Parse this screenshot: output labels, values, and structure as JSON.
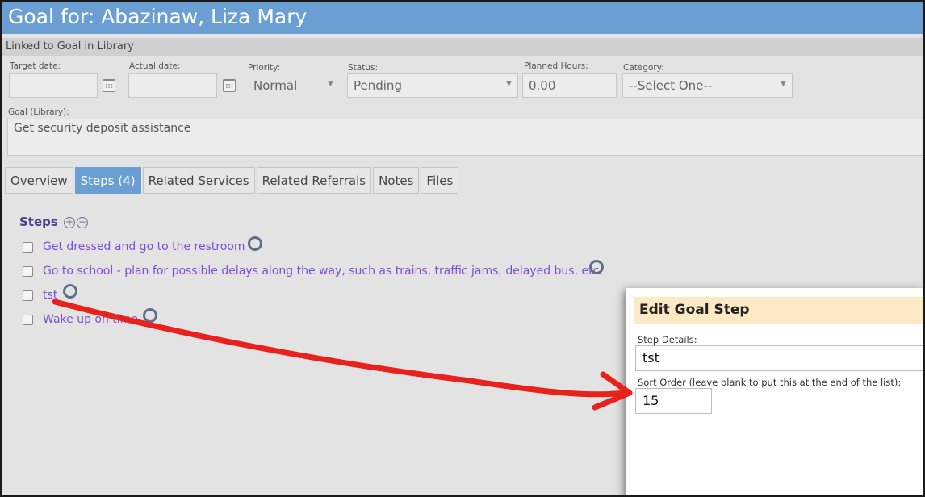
{
  "header": {
    "title": "Goal for: Abazinaw, Liza Mary"
  },
  "linked": {
    "text": "Linked to Goal in Library"
  },
  "fields": {
    "target_date": {
      "label": "Target date:",
      "value": ""
    },
    "actual_date": {
      "label": "Actual date:",
      "value": ""
    },
    "priority": {
      "label": "Priority:",
      "value": "Normal"
    },
    "status": {
      "label": "Status:",
      "value": "Pending"
    },
    "planned_hours": {
      "label": "Planned Hours:",
      "value": "0.00"
    },
    "category": {
      "label": "Category:",
      "value": "--Select One--"
    }
  },
  "goal_library": {
    "label": "Goal (Library):",
    "value": "Get security deposit assistance"
  },
  "tabs": [
    {
      "label": "Overview"
    },
    {
      "label": "Steps (4)"
    },
    {
      "label": "Related Services"
    },
    {
      "label": "Related Referrals"
    },
    {
      "label": "Notes"
    },
    {
      "label": "Files"
    }
  ],
  "steps": {
    "title": "Steps",
    "add_glyph": "+",
    "remove_glyph": "−",
    "items": [
      {
        "text": "Get dressed and go to the restroom"
      },
      {
        "text": "Go to school - plan for possible delays along the way, such as trains, traffic jams, delayed bus, etc."
      },
      {
        "text": "tst"
      },
      {
        "text": "Wake up on time"
      }
    ]
  },
  "dialog": {
    "title": "Edit Goal Step",
    "step_details_label": "Step Details:",
    "step_details_value": "tst",
    "sort_order_label": "Sort Order (leave blank to put this at the end of the list):",
    "sort_order_value": "15"
  },
  "colors": {
    "title_bar": "#6b9fd4",
    "step_link": "#7a4fd6",
    "dialog_header": "#fde9c4",
    "annotation": "#e8211d"
  }
}
